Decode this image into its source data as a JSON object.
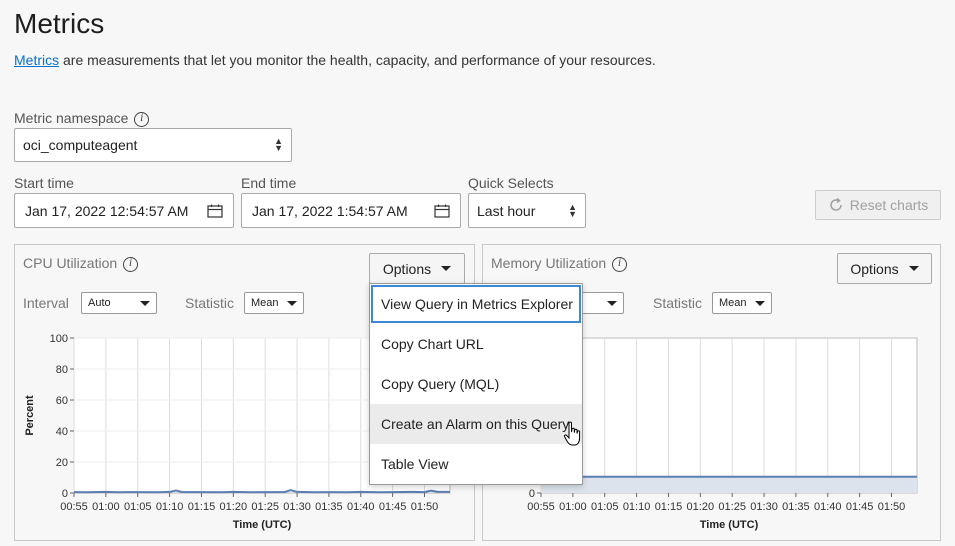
{
  "page": {
    "title": "Metrics",
    "intro_link": "Metrics",
    "intro_text": " are measurements that let you monitor the health, capacity, and performance of your resources."
  },
  "filters": {
    "namespace_label": "Metric namespace",
    "namespace_value": "oci_computeagent",
    "start_label": "Start time",
    "start_value": "Jan 17, 2022 12:54:57 AM",
    "end_label": "End time",
    "end_value": "Jan 17, 2022 1:54:57 AM",
    "quick_label": "Quick Selects",
    "quick_value": "Last hour",
    "reset_label": "Reset charts"
  },
  "cpu_panel": {
    "title": "CPU Utilization",
    "options_label": "Options",
    "interval_label": "Interval",
    "interval_value": "Auto",
    "statistic_label": "Statistic",
    "statistic_value": "Mean"
  },
  "mem_panel": {
    "title": "Memory Utilization",
    "options_label": "Options",
    "statistic_label": "Statistic",
    "statistic_value": "Mean"
  },
  "options_menu": {
    "items": [
      "View Query in Metrics Explorer",
      "Copy Chart URL",
      "Copy Query (MQL)",
      "Create an Alarm on this Query",
      "Table View"
    ]
  },
  "chart_data": [
    {
      "type": "line",
      "ylabel": "Percent",
      "xlabel": "Time (UTC)",
      "ylim": [
        0,
        100
      ],
      "yticks": [
        "0",
        "20",
        "40",
        "60",
        "80",
        "100"
      ],
      "xticks": [
        "00:55",
        "01:00",
        "01:05",
        "01:10",
        "01:15",
        "01:20",
        "01:25",
        "01:30",
        "01:35",
        "01:40",
        "01:45",
        "01:50"
      ],
      "x": [
        "00:55",
        "00:57",
        "01:00",
        "01:02",
        "01:05",
        "01:08",
        "01:10",
        "01:11",
        "01:12",
        "01:15",
        "01:18",
        "01:20",
        "01:23",
        "01:25",
        "01:28",
        "01:29",
        "01:30",
        "01:33",
        "01:35",
        "01:38",
        "01:40",
        "01:43",
        "01:45",
        "01:48",
        "01:50",
        "01:51",
        "01:52",
        "01:54"
      ],
      "y": [
        0.6,
        0.5,
        0.7,
        0.5,
        0.6,
        0.5,
        0.7,
        1.6,
        0.6,
        0.6,
        0.5,
        0.7,
        0.5,
        0.6,
        0.6,
        1.8,
        0.7,
        0.5,
        0.6,
        0.5,
        0.7,
        0.5,
        0.6,
        0.7,
        0.6,
        1.5,
        0.8,
        0.7
      ],
      "grid": true,
      "color": "#5b7fb5"
    },
    {
      "type": "area",
      "xlabel": "Time (UTC)",
      "yticks": [
        "0"
      ],
      "xticks": [
        "00:55",
        "01:00",
        "01:05",
        "01:10",
        "01:15",
        "01:20",
        "01:25",
        "01:30",
        "01:35",
        "01:40",
        "01:45",
        "01:50"
      ],
      "x": [
        "00:55",
        "01:54"
      ],
      "y": [
        10.5,
        10.5
      ],
      "grid": true,
      "color": "#5b7fb5"
    }
  ]
}
